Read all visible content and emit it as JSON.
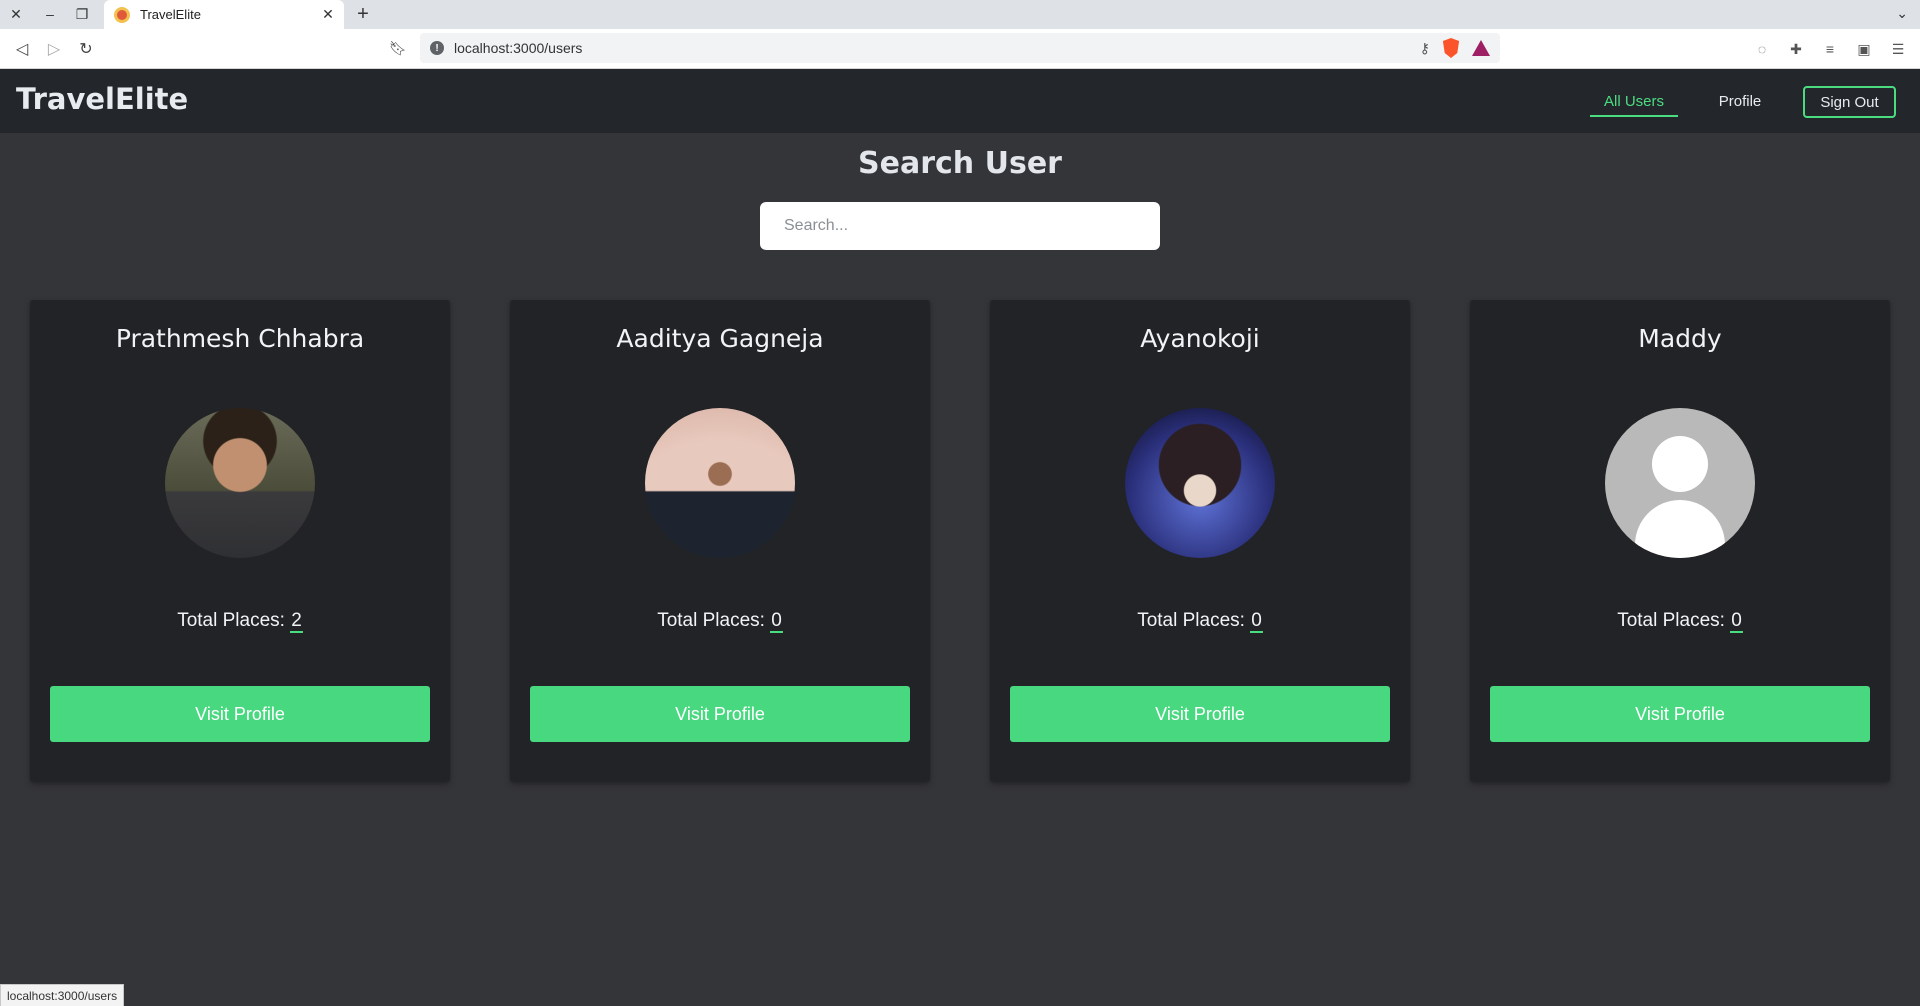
{
  "browser": {
    "tab_title": "TravelElite",
    "url": "localhost:3000/users",
    "status_url": "localhost:3000/users"
  },
  "app": {
    "brand": "TravelElite",
    "nav": {
      "all_users": "All Users",
      "profile": "Profile",
      "sign_out": "Sign Out"
    },
    "accent_color": "#48d980"
  },
  "main": {
    "title": "Search User",
    "search_placeholder": "Search..."
  },
  "users": [
    {
      "name": "Prathmesh Chhabra",
      "places_label": "Total Places: ",
      "places": "2",
      "button": "Visit Profile"
    },
    {
      "name": "Aaditya Gagneja",
      "places_label": "Total Places: ",
      "places": "0",
      "button": "Visit Profile"
    },
    {
      "name": "Ayanokoji",
      "places_label": "Total Places: ",
      "places": "0",
      "button": "Visit Profile"
    },
    {
      "name": "Maddy",
      "places_label": "Total Places: ",
      "places": "0",
      "button": "Visit Profile"
    }
  ]
}
